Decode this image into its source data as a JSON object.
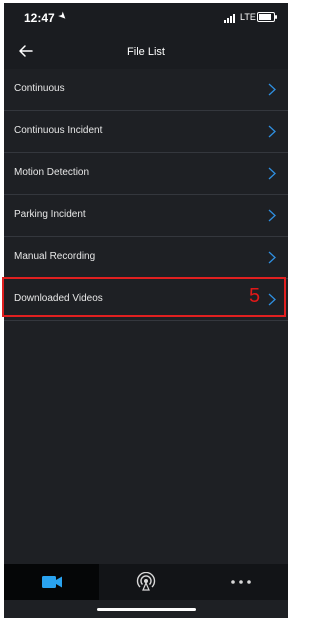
{
  "status": {
    "time": "12:47",
    "network": "LTE"
  },
  "header": {
    "title": "File List"
  },
  "list": {
    "items": [
      {
        "label": "Continuous"
      },
      {
        "label": "Continuous Incident"
      },
      {
        "label": "Motion Detection"
      },
      {
        "label": "Parking Incident"
      },
      {
        "label": "Manual Recording"
      },
      {
        "label": "Downloaded Videos"
      }
    ]
  },
  "annotation": {
    "step": "5",
    "color": "#e02020"
  },
  "tabbar": {
    "tabs": [
      {
        "icon": "video-camera-icon",
        "active": true
      },
      {
        "icon": "broadcast-icon",
        "active": false
      },
      {
        "icon": "more-dots-icon",
        "active": false
      }
    ]
  },
  "colors": {
    "background": "#1e2024",
    "accent": "#2aa3f0",
    "chevron": "#2f8fe0"
  }
}
